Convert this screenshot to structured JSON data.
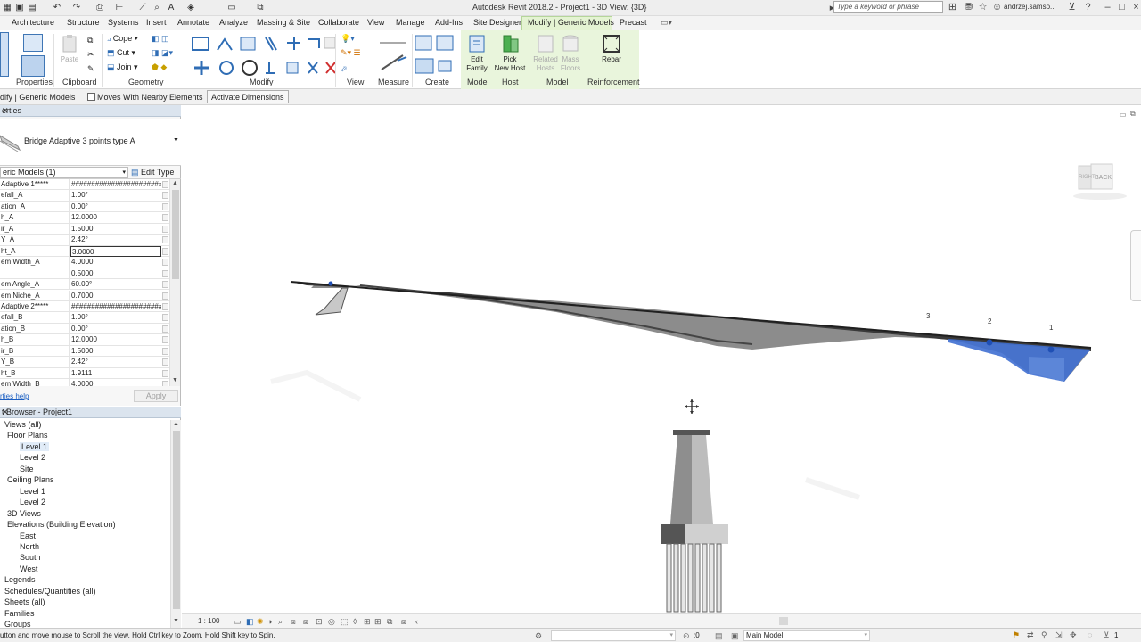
{
  "window": {
    "title": "Autodesk Revit 2018.2 -    Project1 - 3D View: {3D}",
    "search_placeholder": "Type a keyword or phrase",
    "user": "andrzej.samso..."
  },
  "tabs": [
    "Architecture",
    "Structure",
    "Systems",
    "Insert",
    "Annotate",
    "Analyze",
    "Massing & Site",
    "Collaborate",
    "View",
    "Manage",
    "Add-Ins",
    "Site Designer",
    "Modify | Generic Models",
    "Precast"
  ],
  "active_tab": "Modify | Generic Models",
  "ribbon": {
    "panels": [
      "Properties",
      "Clipboard",
      "Geometry",
      "Modify",
      "View",
      "Measure",
      "Create",
      "Mode",
      "Host",
      "Model",
      "Reinforcement"
    ],
    "cope": "Cope",
    "cut": "Cut",
    "join": "Join",
    "paste": "Paste",
    "edit_family": [
      "Edit",
      "Family"
    ],
    "pick_new_host": [
      "Pick",
      "New Host"
    ],
    "related_hosts": [
      "Related",
      "Hosts"
    ],
    "mass_floors": [
      "Mass",
      "Floors"
    ],
    "rebar": "Rebar"
  },
  "options_bar": {
    "label": "dify | Generic Models",
    "moves_with": "Moves With Nearby Elements",
    "activate_dimensions": "Activate Dimensions"
  },
  "properties": {
    "title": "erties",
    "type_name": "Bridge Adaptive 3 points type A",
    "instance_filter": "eric Models (1)",
    "edit_type": "Edit Type",
    "help": "rties help",
    "apply": "Apply",
    "rows": [
      {
        "name": "Adaptive 1*****",
        "value": "##########################"
      },
      {
        "name": "efall_A",
        "value": "1.00°"
      },
      {
        "name": "ation_A",
        "value": "0.00°"
      },
      {
        "name": "h_A",
        "value": "12.0000"
      },
      {
        "name": "ir_A",
        "value": "1.5000"
      },
      {
        "name": "Y_A",
        "value": "2.42°"
      },
      {
        "name": "ht_A",
        "value": "3.0000"
      },
      {
        "name": "em Width_A",
        "value": "4.0000"
      },
      {
        "name": "",
        "value": "0.5000"
      },
      {
        "name": "em Angle_A",
        "value": "60.00°"
      },
      {
        "name": "em Niche_A",
        "value": "0.7000"
      },
      {
        "name": "Adaptive 2*****",
        "value": "##########################"
      },
      {
        "name": "efall_B",
        "value": "1.00°"
      },
      {
        "name": "ation_B",
        "value": "0.00°"
      },
      {
        "name": "h_B",
        "value": "12.0000"
      },
      {
        "name": "ir_B",
        "value": "1.5000"
      },
      {
        "name": "Y_B",
        "value": "2.42°"
      },
      {
        "name": "ht_B",
        "value": "1.9111"
      },
      {
        "name": "em Width_B",
        "value": "4.0000"
      }
    ]
  },
  "browser": {
    "title": "t Browser - Project1",
    "nodes": [
      "Views (all)",
      "Floor Plans",
      "Level 1",
      "Level 2",
      "Site",
      "Ceiling Plans",
      "Level 1",
      "Level 2",
      "3D Views",
      "Elevations (Building Elevation)",
      "East",
      "North",
      "South",
      "West",
      "Legends",
      "Schedules/Quantities (all)",
      "Sheets (all)",
      "Families",
      "Groups"
    ]
  },
  "canvas": {
    "viewcube_right": "RIGHT",
    "viewcube_back": "BACK",
    "point_labels": [
      "3",
      "2",
      "1"
    ],
    "colors": {
      "deck": "#8a8a8a",
      "selected": "#3f6fd1",
      "pier": "#bdbdbd"
    }
  },
  "view_control": {
    "scale": "1 : 100"
  },
  "status": {
    "text": "utton and move mouse to Scroll the view. Hold Ctrl key to Zoom. Hold Shift key to Spin.",
    "zero": ":0",
    "model": "Main Model",
    "filter_count": "1"
  }
}
